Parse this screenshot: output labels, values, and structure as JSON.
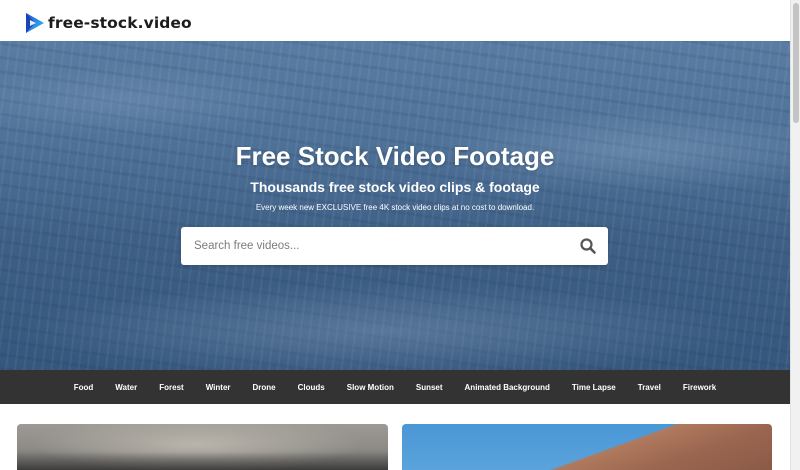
{
  "header": {
    "logo_text": "free-stock.video",
    "logo_icon": "play-logo-icon"
  },
  "hero": {
    "title": "Free Stock Video Footage",
    "subtitle": "Thousands free stock video clips & footage",
    "tagline": "Every week new EXCLUSIVE free 4K stock video clips at no cost to download."
  },
  "search": {
    "placeholder": "Search free videos...",
    "value": "",
    "icon": "search-icon"
  },
  "categories": [
    "Food",
    "Water",
    "Forest",
    "Winter",
    "Drone",
    "Clouds",
    "Slow Motion",
    "Sunset",
    "Animated Background",
    "Time Lapse",
    "Travel",
    "Firework"
  ],
  "colors": {
    "category_bar": "#333333",
    "hero_water": "#4f7299",
    "logo_blue": "#2f6fe0",
    "logo_cyan": "#34c6f2"
  }
}
